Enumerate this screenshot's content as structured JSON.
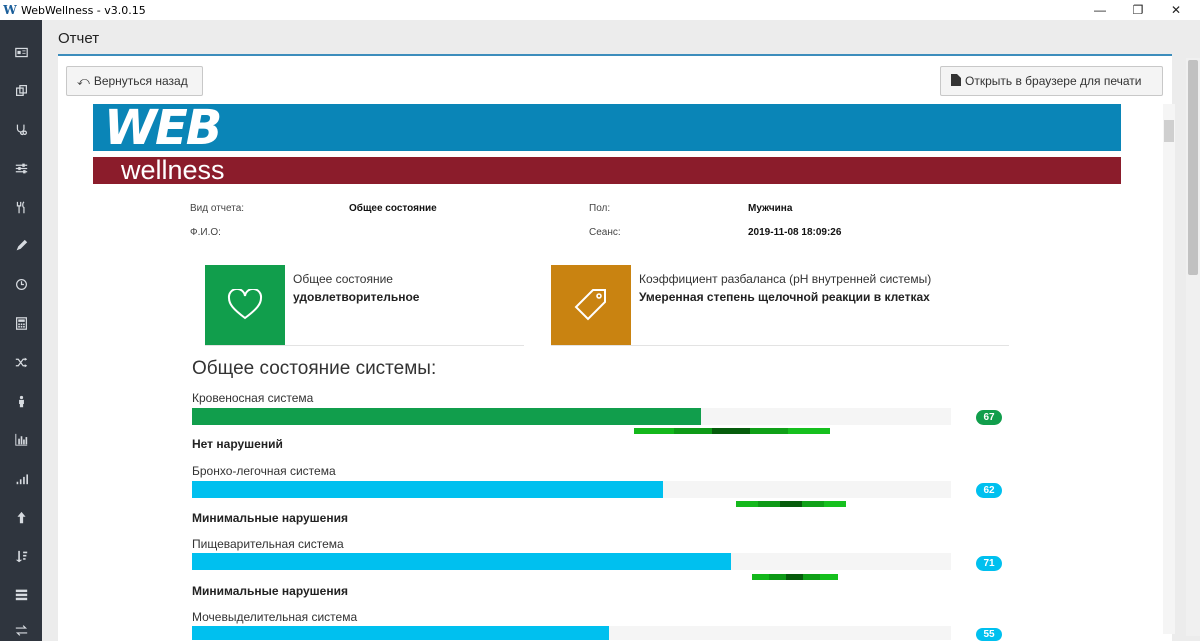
{
  "window": {
    "title": "WebWellness - v3.0.15"
  },
  "page": {
    "title": "Отчет"
  },
  "toolbar": {
    "back_label": "Вернуться назад",
    "print_label": "Открыть в браузере для печати"
  },
  "logo": {
    "web": "WEB",
    "wellness": "wellness"
  },
  "colors": {
    "banner_blue": "#0a85b7",
    "banner_red": "#8b1c2b",
    "green": "#119e4c",
    "blue": "#00c0ef",
    "orange": "#c98311",
    "accent": "#3c8dbc"
  },
  "info": {
    "report_type_label": "Вид отчета:",
    "report_type_value": "Общее состояние",
    "name_label": "Ф.И.О:",
    "gender_label": "Пол:",
    "gender_value": "Мужчина",
    "session_label": "Сеанс:",
    "session_value": "2019-11-08 18:09:26"
  },
  "cards": [
    {
      "label": "Общее состояние",
      "value": "удовлетворительное",
      "icon": "heart-icon"
    },
    {
      "label": "Коэффициент разбаланса (pH внутренней системы)",
      "value": "Умеренная степень щелочной реакции в клетках",
      "icon": "tag-icon"
    }
  ],
  "section": {
    "title": "Общее состояние системы:"
  },
  "systems": [
    {
      "name": "Кровеносная система",
      "value": 67,
      "color": "#119e4c",
      "status": "Нет нарушений"
    },
    {
      "name": "Бронхо-легочная система",
      "value": 62,
      "color": "#00c0ef",
      "status": "Минимальные нарушения"
    },
    {
      "name": "Пищеварительная система",
      "value": 71,
      "color": "#00c0ef",
      "status": "Минимальные нарушения"
    },
    {
      "name": "Мочевыделительная система",
      "value": 55,
      "color": "#00c0ef",
      "status": ""
    }
  ],
  "sidebar": {
    "icons": [
      "id-card-icon",
      "copy-icon",
      "stethoscope-icon",
      "sliders-icon",
      "cutlery-icon",
      "pencil-icon",
      "clock-icon",
      "calculator-icon",
      "shuffle-icon",
      "person-icon",
      "bar-chart-icon",
      "signal-icon",
      "arrow-up-icon",
      "sort-icon",
      "server-icon",
      "exchange-icon"
    ]
  }
}
